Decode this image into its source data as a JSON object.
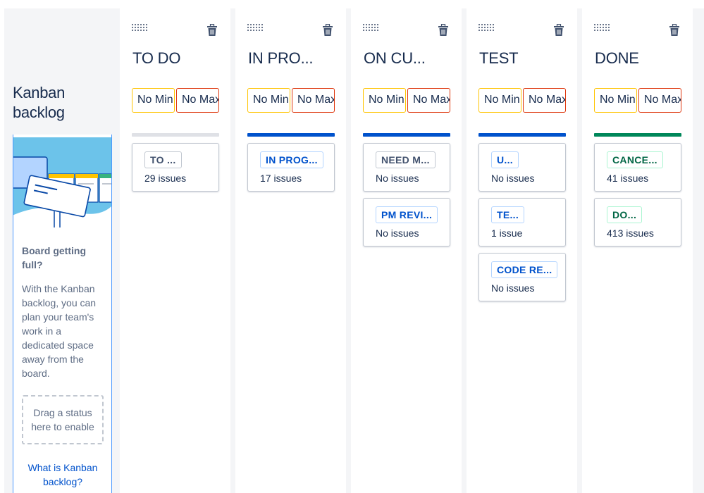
{
  "backlog": {
    "title_line1": "Kanban",
    "title_line2": "backlog",
    "heading": "Board getting full?",
    "description": "With the Kanban backlog, you can plan your team's work in a dedicated space away from the board.",
    "drop_hint": "Drag a status here to enable",
    "link": "What is Kanban backlog?"
  },
  "limits": {
    "min_placeholder": "No Min",
    "max_placeholder": "No Max"
  },
  "colors": {
    "grey": "#dfe1e6",
    "blue": "#0052cc",
    "green": "#00875a"
  },
  "columns": [
    {
      "title": "TO DO",
      "bar": "grey",
      "statuses": [
        {
          "label": "TO ...",
          "count": "29 issues",
          "style": "grey"
        }
      ]
    },
    {
      "title": "IN PRO...",
      "bar": "blue",
      "statuses": [
        {
          "label": "IN PROG...",
          "count": "17 issues",
          "style": "blue"
        }
      ]
    },
    {
      "title": "ON CU...",
      "bar": "blue",
      "statuses": [
        {
          "label": "NEED M...",
          "count": "No issues",
          "style": "grey"
        },
        {
          "label": "PM REVI...",
          "count": "No issues",
          "style": "blue"
        }
      ]
    },
    {
      "title": "TEST",
      "bar": "blue",
      "statuses": [
        {
          "label": "U...",
          "count": "No issues",
          "style": "blue"
        },
        {
          "label": "TE...",
          "count": "1 issue",
          "style": "blue"
        },
        {
          "label": "CODE RE...",
          "count": "No issues",
          "style": "blue"
        }
      ]
    },
    {
      "title": "DONE",
      "bar": "green",
      "statuses": [
        {
          "label": "CANCE...",
          "count": "41 issues",
          "style": "green"
        },
        {
          "label": "DO...",
          "count": "413 issues",
          "style": "green"
        }
      ]
    }
  ]
}
